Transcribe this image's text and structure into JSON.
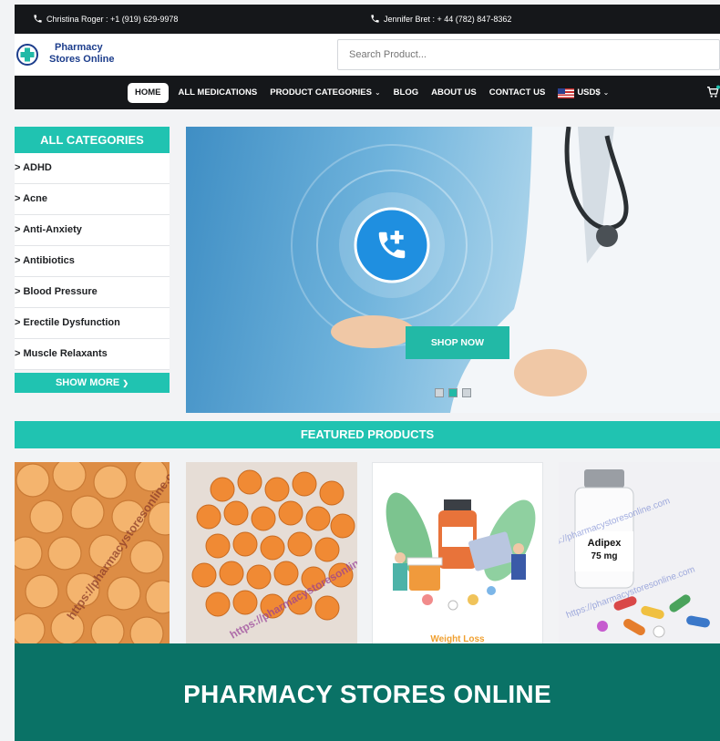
{
  "topbar": {
    "contact_left": "Christina Roger : +1 (919) 629-9978",
    "contact_right": "Jennifer Bret : + 44 (782) 847-8362"
  },
  "logo": {
    "line1": "Pharmacy",
    "line2": "Stores Online"
  },
  "search": {
    "placeholder": "Search Product..."
  },
  "nav": {
    "home": "HOME",
    "items": [
      "ALL MEDICATIONS",
      "PRODUCT CATEGORIES",
      "BLOG",
      "ABOUT US",
      "CONTACT US"
    ],
    "currency": "USD$"
  },
  "sidebar": {
    "title": "ALL CATEGORIES",
    "categories": [
      "> ADHD",
      "> Acne",
      "> Anti-Anxiety",
      "> Antibiotics",
      "> Blood Pressure",
      "> Erectile Dysfunction",
      "> Muscle Relaxants"
    ],
    "show_more": "SHOW MORE"
  },
  "hero": {
    "button": "SHOP NOW",
    "active_slide": 2,
    "slide_count": 3
  },
  "featured": {
    "title": "FEATURED PRODUCTS"
  },
  "products": [
    {
      "watermark": "https://pharmacystoresonline.com"
    },
    {
      "watermark": "https://pharmacystoresonline.com"
    },
    {
      "caption": "Weight Loss"
    },
    {
      "bottle_label_1": "Adipex",
      "bottle_label_2": "75 mg",
      "watermark": "https://pharmacystoresonline.com"
    }
  ],
  "banner": {
    "text": "PHARMACY STORES ONLINE"
  },
  "colors": {
    "teal": "#20c3b1",
    "dark_teal": "#0a7266",
    "navbar": "#15171a",
    "brand_blue": "#1c3d8c"
  }
}
